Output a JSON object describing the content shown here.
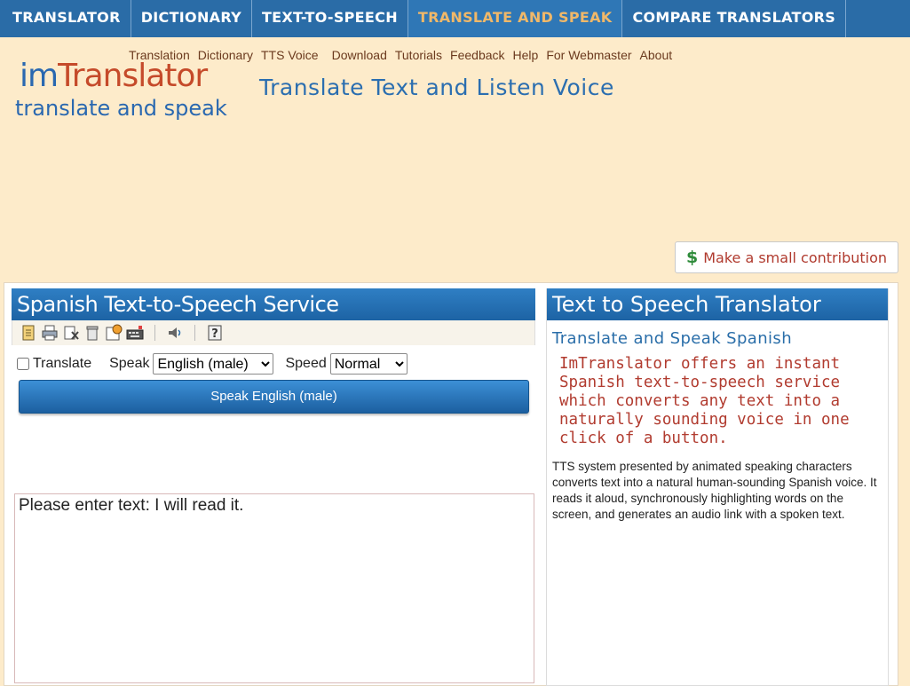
{
  "top_nav": {
    "tabs": [
      {
        "label": "TRANSLATOR",
        "active": false
      },
      {
        "label": "DICTIONARY",
        "active": false
      },
      {
        "label": "TEXT-TO-SPEECH",
        "active": false
      },
      {
        "label": "TRANSLATE AND SPEAK",
        "active": true
      },
      {
        "label": "COMPARE TRANSLATORS",
        "active": false
      }
    ]
  },
  "sub_nav": {
    "links": [
      "Translation",
      "Dictionary",
      "TTS Voice",
      "Download",
      "Tutorials",
      "Feedback",
      "Help",
      "For Webmaster",
      "About"
    ]
  },
  "logo": {
    "wordmark_im": "im",
    "wordmark_translator": "Translator",
    "tagline": "translate and speak"
  },
  "page_heading": "Translate Text and Listen Voice",
  "contribution": {
    "icon": "dollar-sign",
    "symbol": "$",
    "label": "Make a small contribution"
  },
  "left_panel": {
    "title": "Spanish Text-to-Speech Service",
    "toolbar_icons": [
      "clipboard-icon",
      "print-icon",
      "clear-text-icon",
      "trash-icon",
      "settings-icon",
      "keyboard-icon",
      "speak-icon",
      "help-icon"
    ],
    "translate_label": "Translate",
    "translate_checked": false,
    "speak_label": "Speak",
    "speak_value": "English (male)",
    "speed_label": "Speed",
    "speed_value": "Normal",
    "speak_button": "Speak English (male)",
    "text_input": "Please enter text: I will read it."
  },
  "right_panel": {
    "title": "Text to Speech Translator",
    "subtitle": "Translate and Speak Spanish",
    "lead": "ImTranslator offers an instant Spanish text-to-speech service which converts any text into a naturally sounding voice in one click of a button.",
    "body": "TTS system presented by animated speaking characters converts text into a natural human-sounding Spanish voice. It reads it aloud, synchronously highlighting words on the screen, and generates an audio link with a spoken text."
  },
  "colors": {
    "nav_bg": "#2a6ca7",
    "active_tab": "#f0b869",
    "page_bg": "#fdebca",
    "accent_red": "#b13b2f",
    "accent_blue": "#2a6ea9"
  }
}
